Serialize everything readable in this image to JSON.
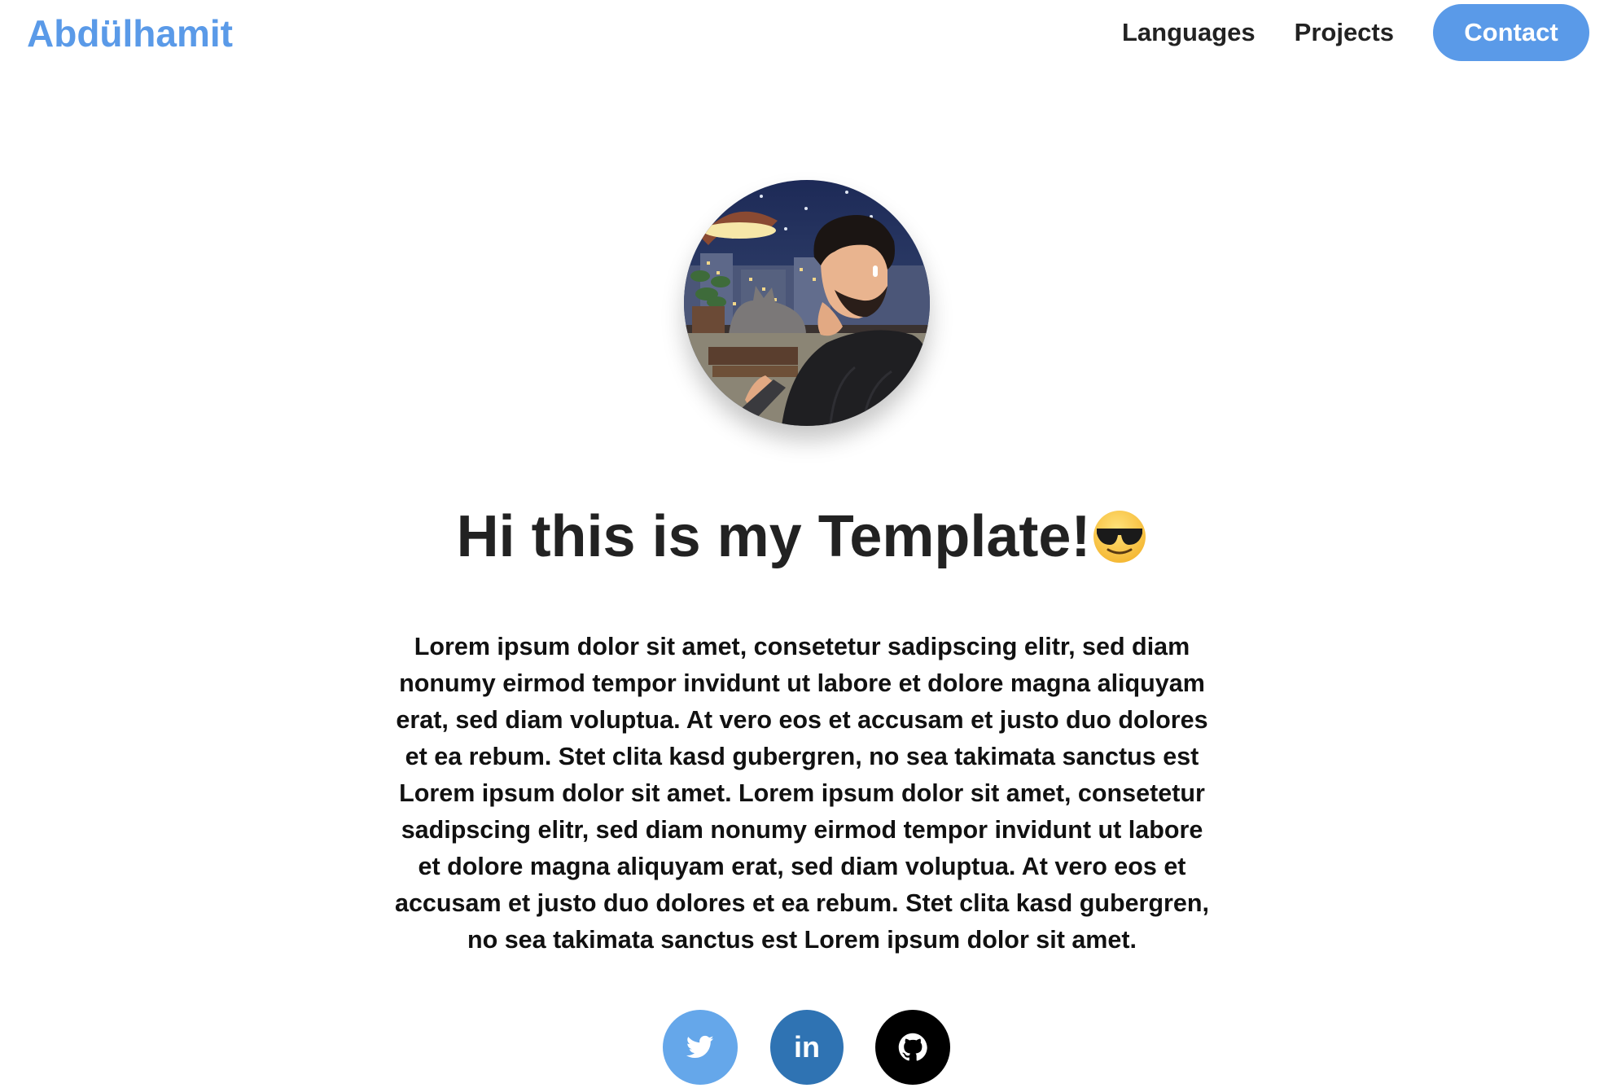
{
  "navbar": {
    "brand": "Abdülhamit",
    "links": [
      {
        "label": "Languages"
      },
      {
        "label": "Projects"
      }
    ],
    "contact_label": "Contact"
  },
  "hero": {
    "avatar_icon": "profile-illustration",
    "title": "Hi this is my Template!",
    "title_emoji": "smiling-face-with-sunglasses",
    "description": "Lorem ipsum dolor sit amet, consetetur sadipscing elitr, sed diam nonumy eirmod tempor invidunt ut labore et dolore magna aliquyam erat, sed diam voluptua. At vero eos et accusam et justo duo dolores et ea rebum. Stet clita kasd gubergren, no sea takimata sanctus est Lorem ipsum dolor sit amet. Lorem ipsum dolor sit amet, consetetur sadipscing elitr, sed diam nonumy eirmod tempor invidunt ut labore et dolore magna aliquyam erat, sed diam voluptua. At vero eos et accusam et justo duo dolores et ea rebum. Stet clita kasd gubergren, no sea takimata sanctus est Lorem ipsum dolor sit amet."
  },
  "socials": [
    {
      "icon": "twitter-icon",
      "color": "#65a7ea"
    },
    {
      "icon": "linkedin-icon",
      "label": "in",
      "color": "#2f73b3"
    },
    {
      "icon": "github-icon",
      "color": "#000000"
    }
  ],
  "colors": {
    "accent": "#5a9ae8",
    "text": "#222222"
  }
}
